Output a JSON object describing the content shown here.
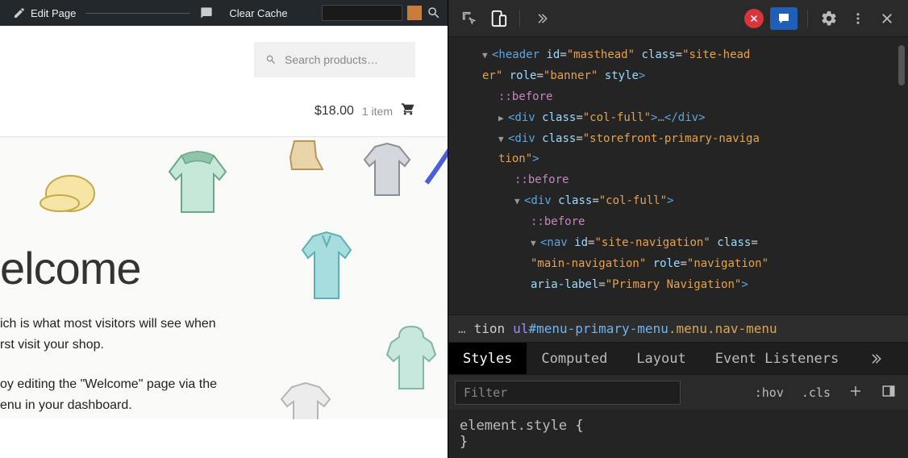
{
  "admin_bar": {
    "edit_page": "Edit Page",
    "clear_cache": "Clear Cache"
  },
  "search": {
    "placeholder": "Search products…"
  },
  "cart": {
    "price": "$18.00",
    "count": "1 item"
  },
  "hero": {
    "title_fragment": "elcome",
    "line1": "ich is what most visitors will see when",
    "line2": "rst visit your shop.",
    "line3": "oy editing the \"Welcome\" page via the",
    "line4": "enu in your dashboard."
  },
  "devtools": {
    "elements": {
      "header_open1": "<header",
      "header_id_attr": "id",
      "header_id_val": "\"masthead\"",
      "header_class_attr": "class",
      "header_class_val_a": "\"site-head",
      "header_class_val_b": "er\"",
      "header_role_attr": "role",
      "header_role_val": "\"banner\"",
      "header_style_attr": "style",
      "header_close": ">",
      "before": "::before",
      "div_open": "<div",
      "class_attr": "class",
      "col_full_val": "\"col-full\"",
      "dots": "…",
      "div_close": "</div>",
      "spn_val_a": "\"storefront-primary-naviga",
      "spn_val_b": "tion\"",
      "close": ">",
      "nav_open": "<nav",
      "nav_id_attr": "id",
      "nav_id_val": "\"site-navigation\"",
      "nav_class_val": "\"main-navigation\"",
      "nav_role_attr": "role",
      "nav_role_val": "\"navigation\"",
      "nav_aria_attr": "aria-label",
      "nav_aria_val": "\"Primary Navigation\""
    },
    "breadcrumb": {
      "dots": "…",
      "prev": "tion",
      "tag": "ul",
      "id": "#menu-primary-menu",
      "classes": ".menu.nav-menu"
    },
    "tabs": {
      "styles": "Styles",
      "computed": "Computed",
      "layout": "Layout",
      "event_listeners": "Event Listeners"
    },
    "filter": {
      "placeholder": "Filter",
      "hov": ":hov",
      "cls": ".cls"
    },
    "styles_body": {
      "selector": "element.style",
      "open": "{",
      "close": "}"
    }
  }
}
